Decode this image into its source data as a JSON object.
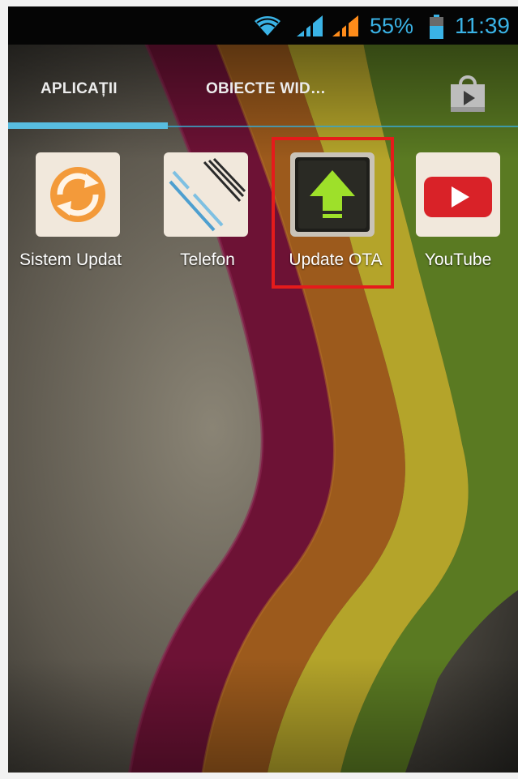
{
  "status_bar": {
    "wifi_icon": "wifi-icon",
    "signal_icon": "cell-signal-icon",
    "battery_percent": "55%",
    "battery_icon": "battery-icon",
    "time": "11:39",
    "text_color": "#3ab3e6"
  },
  "tabs": [
    {
      "label": "APLICAȚII",
      "selected": true
    },
    {
      "label": "OBIECTE WID…",
      "selected": false
    }
  ],
  "store_icon": "play-store-icon",
  "apps": [
    {
      "label": "Sistem Updat",
      "icon": "system-update-icon"
    },
    {
      "label": "Telefon",
      "icon": "phone-icon"
    },
    {
      "label": "Update OTA",
      "icon": "update-ota-icon",
      "highlighted": true
    },
    {
      "label": "YouTube",
      "icon": "youtube-icon"
    }
  ],
  "colors": {
    "accent": "#58bde0",
    "highlight": "#e51b1b"
  }
}
